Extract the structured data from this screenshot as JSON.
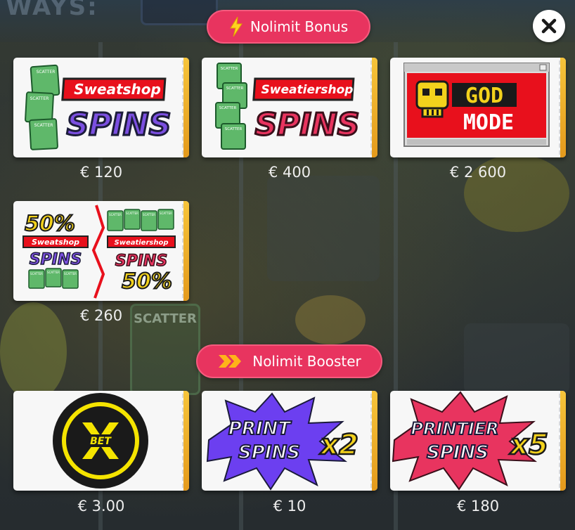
{
  "background": {
    "ways_label": "WAYS:",
    "scatter_label": "SCATTER"
  },
  "sections": {
    "bonus": {
      "title": "Nolimit Bonus",
      "icon": "lightning-bolt-icon"
    },
    "booster": {
      "title": "Nolimit Booster",
      "icon": "chevrons-right-icon"
    }
  },
  "close": {
    "icon": "close-icon"
  },
  "bonus_items": [
    {
      "id": "sweatshop",
      "banner": "Sweatshop",
      "word": "SPINS",
      "card_label": "SCATTER",
      "price": "€ 120"
    },
    {
      "id": "sweatiershop",
      "banner": "Sweatiershop",
      "word": "SPINS",
      "card_label": "SCATTER",
      "price": "€ 400"
    },
    {
      "id": "god-mode",
      "line1": "GOD",
      "line2": "MODE",
      "price": "€ 2 600"
    },
    {
      "id": "combo",
      "left_pct": "50%",
      "left_banner": "Sweatshop",
      "left_word": "SPINS",
      "right_banner": "Sweatiershop",
      "right_word": "SPINS",
      "right_pct": "50%",
      "card_label": "SCATTER",
      "price": "€ 260"
    }
  ],
  "booster_items": [
    {
      "id": "xbet",
      "logo_text": "BET",
      "price": "€ 3.00"
    },
    {
      "id": "print-spins",
      "line1": "PRINT",
      "line2": "SPINS",
      "multiplier": "x2",
      "price": "€ 10"
    },
    {
      "id": "printier-spins",
      "line1": "PRINTIER",
      "line2": "SPINS",
      "multiplier": "x5",
      "price": "€ 180"
    }
  ],
  "colors": {
    "pill": "#e8345f",
    "sweatshop_purple": "#7b4fe0",
    "sweatier_red": "#e8345f",
    "god_red": "#e8101c",
    "xbet_yellow": "#f5e400",
    "print_purple": "#6c3ff0",
    "printier_red": "#e8345f",
    "stub_gold": "#f1b32c"
  }
}
